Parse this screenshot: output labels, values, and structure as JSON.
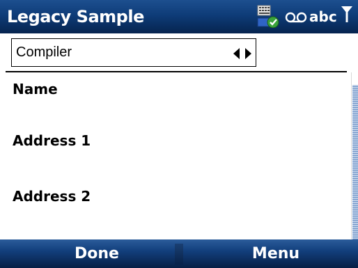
{
  "title_bar": {
    "title": "Legacy Sample",
    "status_icons": [
      "keyboard-icon",
      "voicemail-icon",
      "signal-icon"
    ],
    "input_mode": "abc"
  },
  "form": {
    "picker": {
      "value": "Compiler",
      "arrows": [
        "arrow-left-icon",
        "arrow-right-icon"
      ]
    },
    "labels": {
      "name": "Name",
      "address1": "Address 1",
      "address2": "Address 2"
    }
  },
  "softkeys": {
    "left": "Done",
    "right": "Menu"
  },
  "colors": {
    "title_bar": "#0e3c78",
    "softkey_bar": "#123f7c",
    "scroll_thumb": "#6f93c7"
  }
}
